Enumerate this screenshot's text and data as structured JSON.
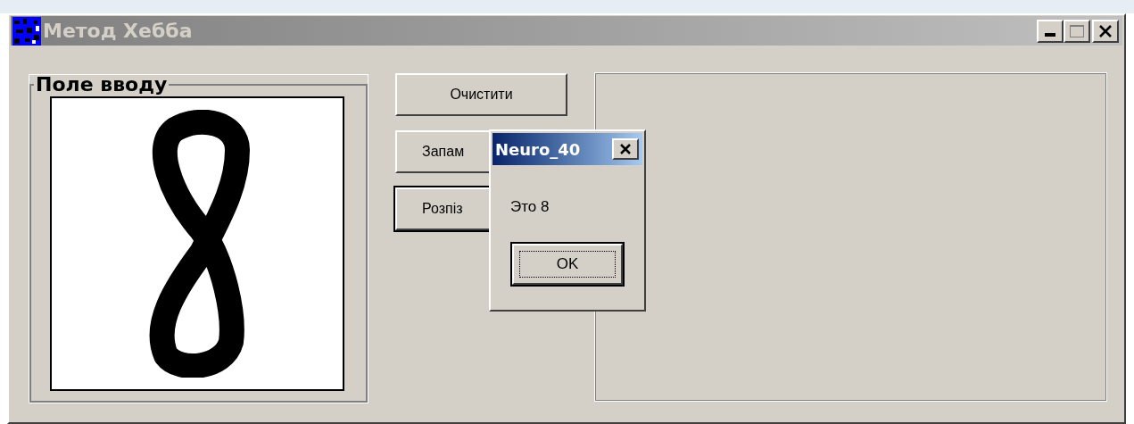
{
  "window": {
    "title": "Метод Хебба",
    "active": false
  },
  "group": {
    "label": "Поле вводу"
  },
  "buttons": [
    {
      "label": "Очистити",
      "default": false
    },
    {
      "label": "Запам",
      "default": false
    },
    {
      "label": "Розпіз",
      "default": true
    }
  ],
  "dialog": {
    "title": "Neuro_40",
    "message": "Это 8",
    "button": "OK"
  }
}
